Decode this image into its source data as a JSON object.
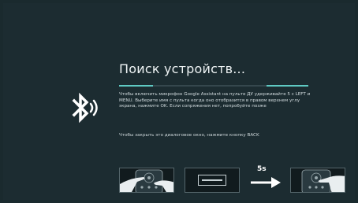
{
  "dialog": {
    "title": "Поиск устройств...",
    "instructions": "Чтобы включить микрофон Google Assistant на пульте ДУ удерживайте 5 с LEFT и MENU. Выберите имя с пульта когда оно отобразится в правом верхнем углу экрана, нажмите OK. Если сопряжения нет, попробуйте позже",
    "close_hint": "Чтобы закрыть это диалоговое окно, нажмите кнопку BACK",
    "progress_fraction": 0.4,
    "step_label": "5s"
  },
  "icons": {
    "bluetooth": "bluetooth-icon",
    "arrow": "arrow-right-icon"
  },
  "colors": {
    "background": "#1c2c31",
    "accent": "#5fc9c3",
    "text": "#eef3f4"
  }
}
